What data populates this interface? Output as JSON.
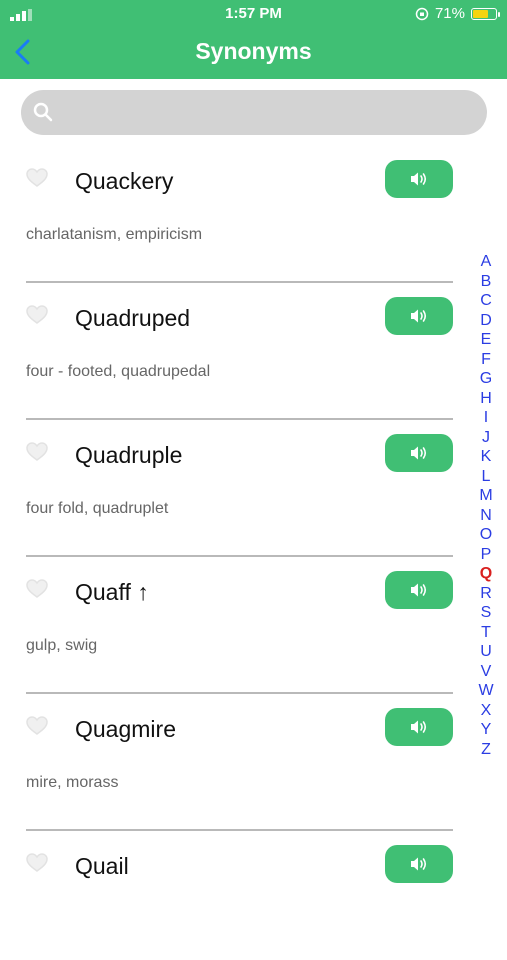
{
  "status_bar": {
    "time": "1:57 PM",
    "battery_percent": "71%",
    "battery_level": 0.71
  },
  "header": {
    "title": "Synonyms"
  },
  "search": {
    "placeholder": "",
    "value": ""
  },
  "entries": [
    {
      "word": "Quackery",
      "synonyms": "charlatanism, empiricism"
    },
    {
      "word": "Quadruped",
      "synonyms": "four - footed, quadrupedal"
    },
    {
      "word": "Quadruple",
      "synonyms": "four fold, quadruplet"
    },
    {
      "word": "Quaff ↑",
      "synonyms": "gulp, swig"
    },
    {
      "word": "Quagmire",
      "synonyms": "mire, morass"
    },
    {
      "word": "Quail",
      "synonyms": ""
    }
  ],
  "alphabet_index": [
    "A",
    "B",
    "C",
    "D",
    "E",
    "F",
    "G",
    "H",
    "I",
    "J",
    "K",
    "L",
    "M",
    "N",
    "O",
    "P",
    "Q",
    "R",
    "S",
    "T",
    "U",
    "V",
    "W",
    "X",
    "Y",
    "Z"
  ],
  "active_letter": "Q",
  "icons": {
    "heart": "heart-outline-icon",
    "speaker": "speaker-icon",
    "back": "chevron-left-icon",
    "search": "search-icon"
  },
  "colors": {
    "accent": "#40bf74",
    "index": "#2b3de3",
    "index_active": "#d9201f",
    "battery": "#f5d40f"
  }
}
